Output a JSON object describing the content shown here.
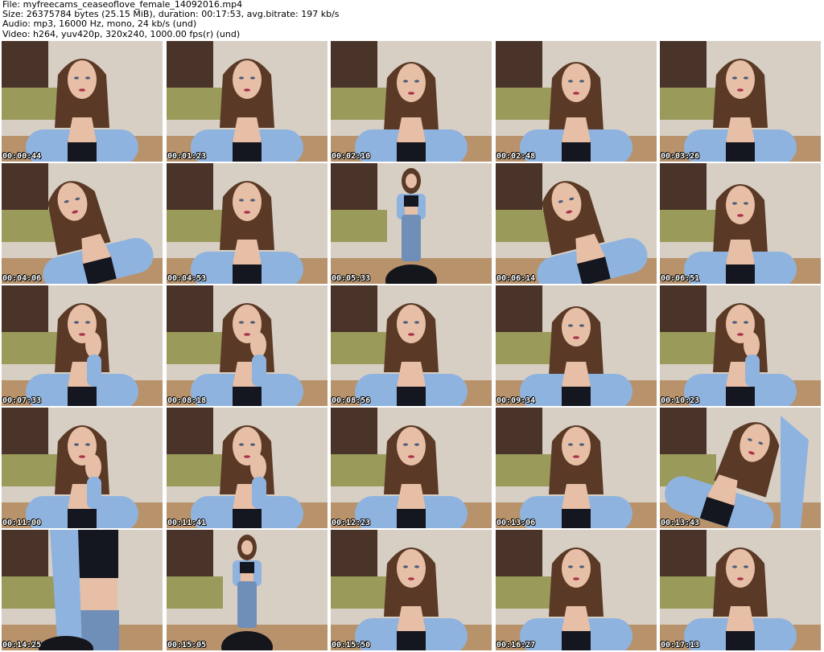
{
  "header": {
    "file_line": "File: myfreecams_ceaseoflove_female_14092016.mp4",
    "size_line": "Size: 26375784 bytes (25.15 MiB), duration: 00:17:53, avg.bitrate: 197 kb/s",
    "audio_line": "Audio: mp3, 16000 Hz, mono, 24 kb/s (und)",
    "video_line": "Video: h264, yuv420p, 320x240, 1000.00 fps(r) (und)"
  },
  "colors": {
    "wall": "#d8cfc4",
    "curtain": "#4a3328",
    "sofa": "#9a9a5a",
    "floor": "#b8926a",
    "hair": "#5a3a26",
    "skin": "#e7bfa6",
    "shirt": "#8fb3df",
    "top": "#141620",
    "jeans": "#6f8fb8"
  },
  "thumbnails": [
    {
      "timestamp": "00:00:44",
      "scene": "closeup"
    },
    {
      "timestamp": "00:01:23",
      "scene": "closeup"
    },
    {
      "timestamp": "00:02:10",
      "scene": "closeup-down"
    },
    {
      "timestamp": "00:02:48",
      "scene": "closeup-down"
    },
    {
      "timestamp": "00:03:26",
      "scene": "closeup"
    },
    {
      "timestamp": "00:04:06",
      "scene": "tilt"
    },
    {
      "timestamp": "00:04:53",
      "scene": "closeup"
    },
    {
      "timestamp": "00:05:33",
      "scene": "standing"
    },
    {
      "timestamp": "00:06:14",
      "scene": "tilt"
    },
    {
      "timestamp": "00:06:51",
      "scene": "closeup-down"
    },
    {
      "timestamp": "00:07:33",
      "scene": "hand"
    },
    {
      "timestamp": "00:08:18",
      "scene": "hand"
    },
    {
      "timestamp": "00:08:56",
      "scene": "closeup"
    },
    {
      "timestamp": "00:09:34",
      "scene": "closeup-down"
    },
    {
      "timestamp": "00:10:23",
      "scene": "hand"
    },
    {
      "timestamp": "00:11:00",
      "scene": "hand"
    },
    {
      "timestamp": "00:11:41",
      "scene": "hand"
    },
    {
      "timestamp": "00:12:23",
      "scene": "closeup"
    },
    {
      "timestamp": "00:13:06",
      "scene": "closeup"
    },
    {
      "timestamp": "00:13:43",
      "scene": "arm-up"
    },
    {
      "timestamp": "00:14:25",
      "scene": "torso"
    },
    {
      "timestamp": "00:15:05",
      "scene": "standing"
    },
    {
      "timestamp": "00:15:50",
      "scene": "closeup"
    },
    {
      "timestamp": "00:16:27",
      "scene": "closeup"
    },
    {
      "timestamp": "00:17:13",
      "scene": "closeup"
    }
  ]
}
